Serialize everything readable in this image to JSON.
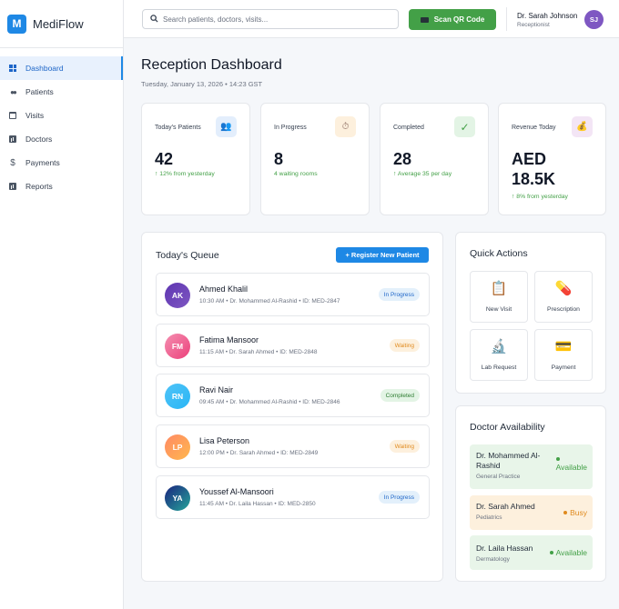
{
  "brand": {
    "logo_letter": "M",
    "name": "MediFlow",
    "accent": "#1e88e5"
  },
  "sidebar": {
    "items": [
      {
        "label": "Dashboard",
        "icon": "grid-icon",
        "active": true
      },
      {
        "label": "Patients",
        "icon": "people-icon"
      },
      {
        "label": "Visits",
        "icon": "calendar-icon"
      },
      {
        "label": "Doctors",
        "icon": "chart-icon"
      },
      {
        "label": "Payments",
        "icon": "dollar-icon"
      },
      {
        "label": "Reports",
        "icon": "chart-icon"
      }
    ]
  },
  "topbar": {
    "search_placeholder": "Search patients, doctors, visits...",
    "scan_label": "Scan QR Code",
    "user_name": "Dr. Sarah Johnson",
    "user_role": "Receptionist",
    "user_initials": "SJ"
  },
  "header": {
    "title": "Reception Dashboard",
    "date": "Tuesday, January 13, 2026 • 14:23 GST"
  },
  "stats": [
    {
      "label": "Today's Patients",
      "value": "42",
      "sub": "↑ 12% from yesterday",
      "icon": "👥"
    },
    {
      "label": "In Progress",
      "value": "8",
      "sub": "4 waiting rooms",
      "icon": "⏱"
    },
    {
      "label": "Completed",
      "value": "28",
      "sub": "↑ Average 35 per day",
      "icon": "✓"
    },
    {
      "label": "Revenue Today",
      "value_line1": "AED",
      "value_line2": "18.5K",
      "sub": "↑ 8% from yesterday",
      "icon": "💰"
    }
  ],
  "queue": {
    "title": "Today's Queue",
    "register_label": "+ Register New Patient",
    "items": [
      {
        "initials": "AK",
        "name": "Ahmed Khalil",
        "meta": "10:30 AM • Dr. Mohammed Al-Rashid • ID: MED-2847",
        "status": "In Progress"
      },
      {
        "initials": "FM",
        "name": "Fatima Mansoor",
        "meta": "11:15 AM • Dr. Sarah Ahmed • ID: MED-2848",
        "status": "Waiting"
      },
      {
        "initials": "RN",
        "name": "Ravi Nair",
        "meta": "09:45 AM • Dr. Mohammed Al-Rashid • ID: MED-2846",
        "status": "Completed"
      },
      {
        "initials": "LP",
        "name": "Lisa Peterson",
        "meta": "12:00 PM • Dr. Sarah Ahmed • ID: MED-2849",
        "status": "Waiting"
      },
      {
        "initials": "YA",
        "name": "Youssef Al-Mansoori",
        "meta": "11:45 AM • Dr. Laila Hassan • ID: MED-2850",
        "status": "In Progress"
      }
    ]
  },
  "quick_actions": {
    "title": "Quick Actions",
    "items": [
      {
        "label": "New Visit",
        "icon": "📋"
      },
      {
        "label": "Prescription",
        "icon": "💊"
      },
      {
        "label": "Lab Request",
        "icon": "🔬"
      },
      {
        "label": "Payment",
        "icon": "💳"
      }
    ]
  },
  "doctors": {
    "title": "Doctor Availability",
    "items": [
      {
        "name": "Dr. Mohammed Al-Rashid",
        "specialty": "General Practice",
        "status": "Available"
      },
      {
        "name": "Dr. Sarah Ahmed",
        "specialty": "Pediatrics",
        "status": "Busy"
      },
      {
        "name": "Dr. Laila Hassan",
        "specialty": "Dermatology",
        "status": "Available"
      }
    ]
  }
}
